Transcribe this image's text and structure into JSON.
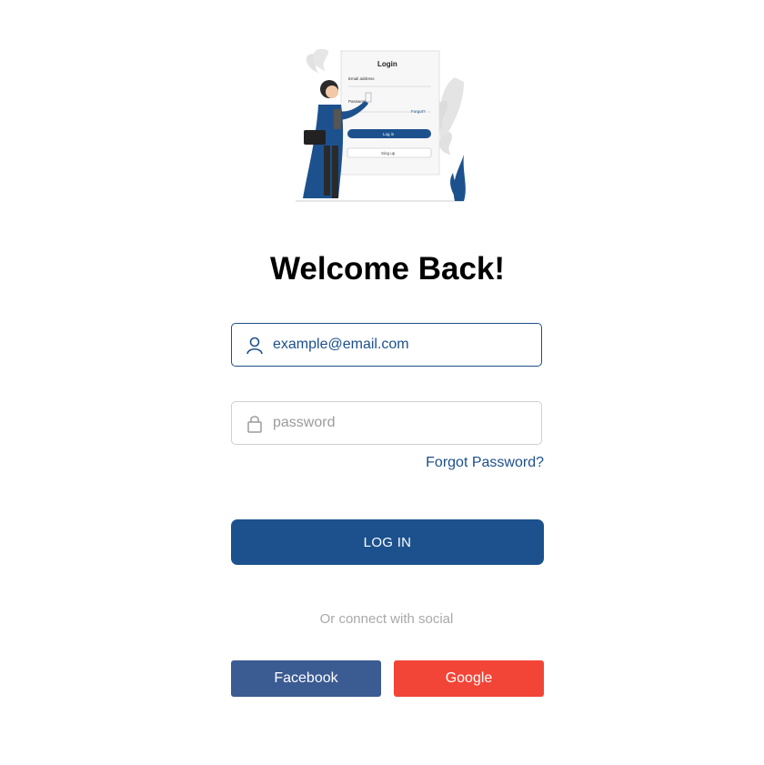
{
  "illustration": {
    "form_title": "Login",
    "email_label": "Email address",
    "password_label": "Password",
    "forgot_label": "Forgot?",
    "login_label": "Log in",
    "signup_label": "Sing up"
  },
  "heading": "Welcome Back!",
  "email": {
    "value": "example@email.com"
  },
  "password": {
    "placeholder": "password"
  },
  "forgot_password": "Forgot Password?",
  "login_button": "LOG IN",
  "social": {
    "prompt": "Or connect with social",
    "facebook": "Facebook",
    "google": "Google"
  },
  "colors": {
    "primary": "#1c518e",
    "facebook": "#3b5b93",
    "google": "#f24537",
    "muted": "#a9a9a9"
  }
}
